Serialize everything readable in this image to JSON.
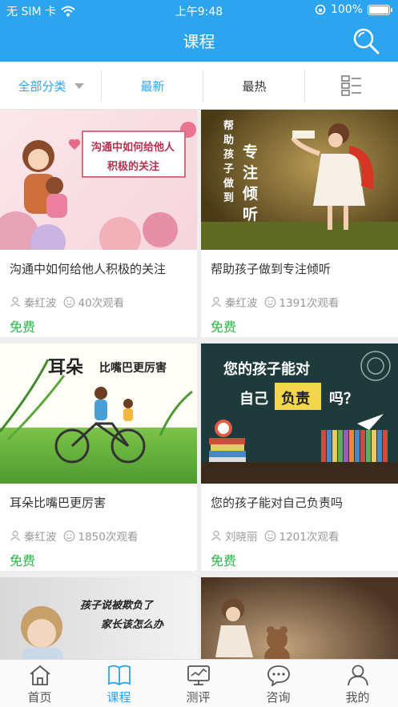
{
  "status": {
    "carrier": "无 SIM 卡",
    "time": "上午9:48",
    "battery": "100%"
  },
  "header": {
    "title": "课程"
  },
  "filters": {
    "category": "全部分类",
    "latest": "最新",
    "hottest": "最热"
  },
  "courses": [
    {
      "title": "沟通中如何给他人积极的关注",
      "author": "秦红波",
      "views": "40次观看",
      "price": "免费",
      "thumb_text": [
        "沟通中如何给他人",
        "积极的关注"
      ]
    },
    {
      "title": "帮助孩子做到专注倾听",
      "author": "秦红波",
      "views": "1391次观看",
      "price": "免费",
      "thumb_text": [
        "帮助孩子做到",
        "专注倾听"
      ]
    },
    {
      "title": "耳朵比嘴巴更厉害",
      "author": "秦红波",
      "views": "1850次观看",
      "price": "免费",
      "thumb_text": [
        "耳朵",
        "比嘴巴更厉害"
      ]
    },
    {
      "title": "您的孩子能对自己负责吗",
      "author": "刘晓丽",
      "views": "1201次观看",
      "price": "免费",
      "thumb_text": [
        "您的孩子能对",
        "自己",
        "负责",
        "吗？"
      ]
    },
    {
      "title": "",
      "author": "",
      "views": "",
      "price": "",
      "thumb_text": [
        "孩子说被欺负了",
        "家长该怎么办"
      ]
    },
    {
      "title": "",
      "author": "",
      "views": "",
      "price": "",
      "thumb_text": []
    }
  ],
  "tabs": [
    {
      "label": "首页",
      "icon": "home-icon"
    },
    {
      "label": "课程",
      "icon": "book-icon"
    },
    {
      "label": "测评",
      "icon": "monitor-chart-icon"
    },
    {
      "label": "咨询",
      "icon": "chat-bubble-icon"
    },
    {
      "label": "我的",
      "icon": "user-icon"
    }
  ],
  "colors": {
    "accent": "#2da4f0",
    "free": "#2bb34a",
    "meta": "#999999"
  }
}
